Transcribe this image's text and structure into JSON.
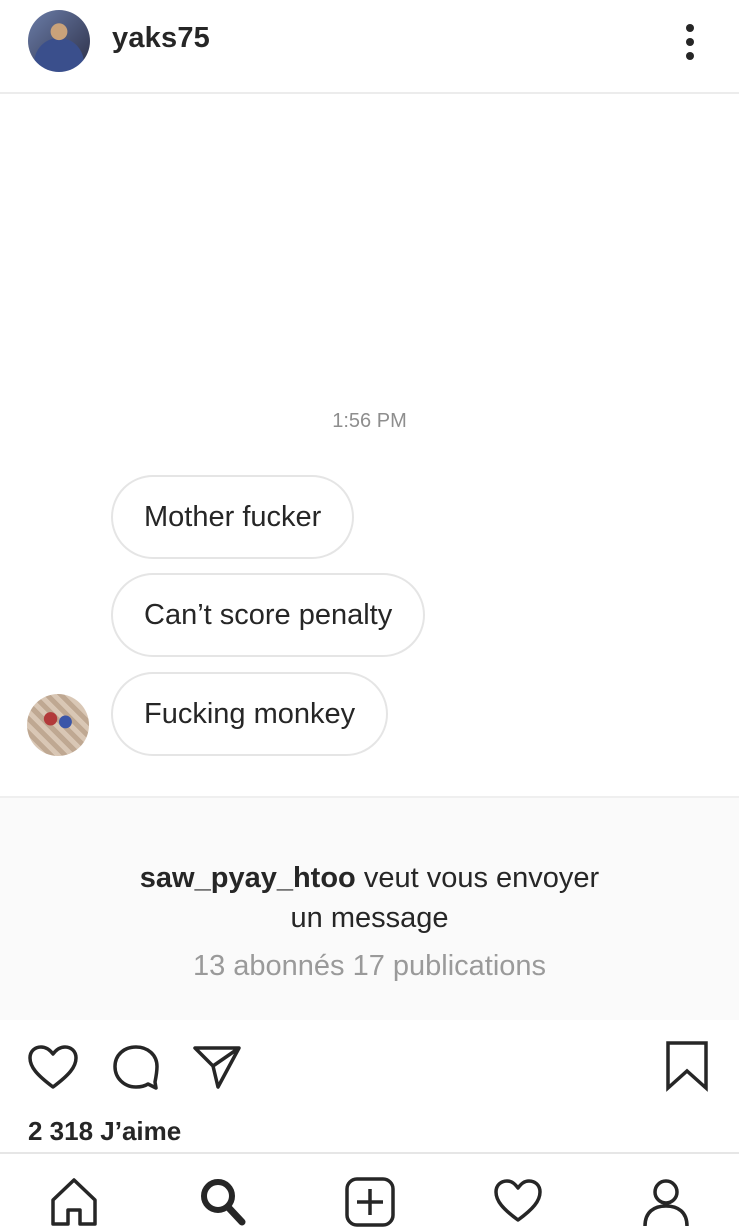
{
  "header": {
    "username": "yaks75",
    "avatar_icon": "profile-photo",
    "more_icon": "vertical-dots-icon"
  },
  "thread": {
    "timestamp": "1:56 PM",
    "messages": [
      {
        "text": "Mother fucker"
      },
      {
        "text": "Can’t score penalty"
      },
      {
        "text": "Fucking monkey"
      }
    ]
  },
  "request": {
    "requester": "saw_pyay_htoo",
    "text_part1": " veut vous envoyer",
    "text_part2": "un message",
    "stats": "13 abonnés 17 publications"
  },
  "actions": {
    "likes": "2 318 J’aime",
    "icons": [
      "heart-icon",
      "comment-icon",
      "share-icon",
      "bookmark-icon"
    ]
  },
  "tabbar": {
    "tabs": [
      "home-icon",
      "search-icon",
      "add-icon",
      "activity-icon",
      "profile-icon"
    ],
    "activity_dot_color": "#ed4956"
  }
}
